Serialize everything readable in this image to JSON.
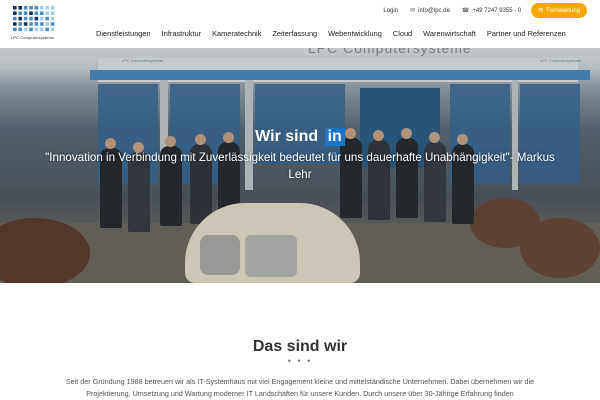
{
  "brand": {
    "name": "LPC Computersysteme",
    "dot_colors": [
      "#1d2f5c",
      "#4d8fc4",
      "#a9d0ec"
    ]
  },
  "topbar": {
    "login": "Login",
    "email": "info@lpc.de",
    "phone": "+49 7247 9355 - 0",
    "fernwartung": "Fernwartung",
    "accent": "#f7a700"
  },
  "nav": {
    "items": [
      "Dienstleistungen",
      "Infrastruktur",
      "Kameratechnik",
      "Zeiterfassung",
      "Webentwicklung",
      "Cloud",
      "Warenwirtschaft",
      "Partner und Referenzen"
    ]
  },
  "hero": {
    "title_prefix": "Wir sind",
    "title_highlight": "in",
    "quote": "\"Innovation in Verbindung mit Zuverlässigkeit bedeutet für uns dauerhafte Unabhängigkeit\"- Markus Lehr",
    "building_sign": "LPC Computersysteme",
    "building_small_sign": "LPC Computersysteme",
    "highlight_color": "#1e74c4"
  },
  "about": {
    "title": "Das sind wir",
    "dots": "• • •",
    "text": "Seit der Gründung 1988 betreuen wir als IT-Systemhaus mit viel Engagement kleine und mittelständische Unternehmen. Dabei übernehmen wir die Projektierung, Umsetzung und Wartung moderner IT Landschaften für unsere Kunden. Durch unsere über 30-Jährige Erfahrung finden"
  }
}
